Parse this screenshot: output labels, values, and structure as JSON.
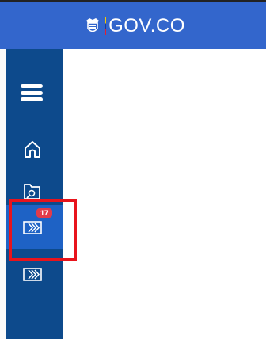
{
  "header": {
    "brand_text": "GOV.CO",
    "background_color": "#3366cc",
    "logo_icon": "colombia-crest-icon"
  },
  "sidebar": {
    "background_color": "#0d4a8c",
    "active_background_color": "#1e62c5",
    "items": [
      {
        "icon": "hamburger-menu-icon"
      },
      {
        "icon": "home-icon"
      },
      {
        "icon": "folder-search-icon"
      },
      {
        "icon": "inbox-arrows-icon",
        "badge": "17",
        "active": true
      },
      {
        "icon": "inbox-arrows-icon"
      }
    ]
  },
  "highlight": {
    "color": "#e8141c"
  }
}
